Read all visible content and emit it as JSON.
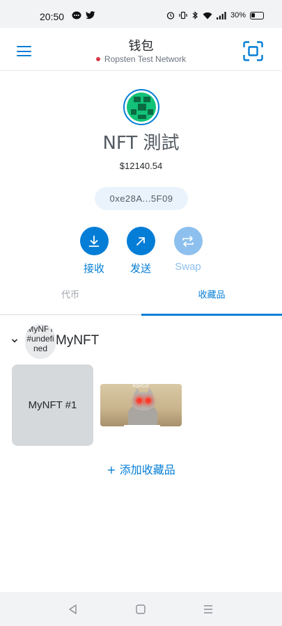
{
  "status_bar": {
    "time": "20:50",
    "battery": "30%",
    "left_icons": [
      "chat-bubble-icon",
      "twitter-bird-icon"
    ],
    "right_icons": [
      "alarm-icon",
      "vibrate-icon",
      "bluetooth-icon",
      "wifi-icon",
      "signal-icon",
      "battery-icon"
    ]
  },
  "header": {
    "title": "钱包",
    "network": "Ropsten Test Network",
    "network_dot_color": "#d73a49"
  },
  "account": {
    "name": "NFT 測試",
    "balance": "$12140.54",
    "address": "0xe28A...5F09"
  },
  "actions": {
    "receive": "接收",
    "send": "发送",
    "swap": "Swap"
  },
  "tabs": {
    "tokens": "代币",
    "collectibles": "收藏品",
    "active": "collectibles"
  },
  "collection": {
    "avatar_text": "MyNFT #undefined",
    "name": "MyNFT",
    "items": [
      {
        "label": "MyNFT #1"
      },
      {
        "caption": "POPCAT"
      }
    ]
  },
  "add_collectible": "+ 添加收藏品",
  "colors": {
    "accent": "#037dd6",
    "accent_disabled": "#8dc0ee",
    "address_bg": "#eaf3fc"
  }
}
